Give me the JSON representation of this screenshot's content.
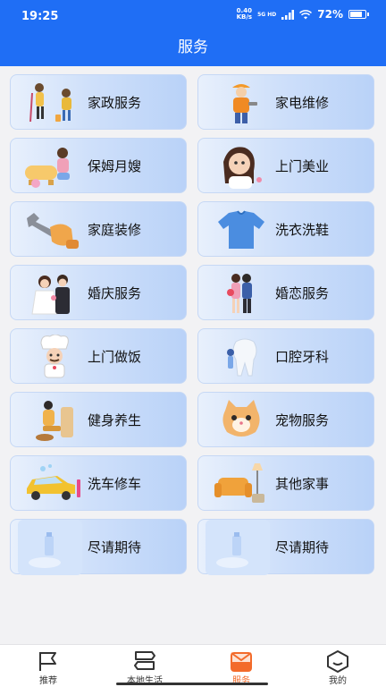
{
  "status_bar": {
    "time": "19:25",
    "net_speed_value": "0.40",
    "net_speed_unit": "KB/s",
    "network_type": "5G HD",
    "battery": "72%"
  },
  "header": {
    "title": "服务"
  },
  "services": [
    {
      "label": "家政服务",
      "icon": "housekeeping-illustration"
    },
    {
      "label": "家电维修",
      "icon": "appliance-repair-illustration"
    },
    {
      "label": "保姆月嫂",
      "icon": "nanny-illustration"
    },
    {
      "label": "上门美业",
      "icon": "beauty-illustration"
    },
    {
      "label": "家庭装修",
      "icon": "renovation-wrench-illustration"
    },
    {
      "label": "洗衣洗鞋",
      "icon": "laundry-shirt-illustration"
    },
    {
      "label": "婚庆服务",
      "icon": "wedding-couple-illustration"
    },
    {
      "label": "婚恋服务",
      "icon": "dating-couple-illustration"
    },
    {
      "label": "上门做饭",
      "icon": "chef-illustration"
    },
    {
      "label": "口腔牙科",
      "icon": "dental-tooth-illustration"
    },
    {
      "label": "健身养生",
      "icon": "wellness-illustration"
    },
    {
      "label": "宠物服务",
      "icon": "pet-cat-illustration"
    },
    {
      "label": "洗车修车",
      "icon": "car-wash-illustration"
    },
    {
      "label": "其他家事",
      "icon": "home-furniture-illustration"
    },
    {
      "label": "尽请期待",
      "icon": "coming-soon-illustration"
    },
    {
      "label": "尽请期待",
      "icon": "coming-soon-illustration"
    }
  ],
  "bottom_nav": [
    {
      "label": "推荐",
      "icon": "flag-icon"
    },
    {
      "label": "本地生活",
      "icon": "signpost-icon"
    },
    {
      "label": "服务",
      "icon": "shopping-bag-icon",
      "active": true
    },
    {
      "label": "我的",
      "icon": "profile-hexagon-icon"
    }
  ],
  "colors": {
    "brand_blue": "#1f6ef5",
    "active_tab": "#f36b2b"
  }
}
